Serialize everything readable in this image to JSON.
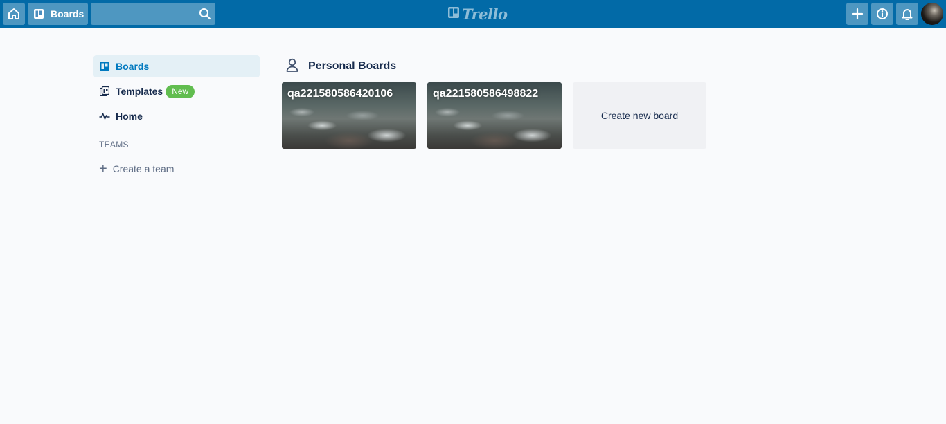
{
  "header": {
    "boards_label": "Boards",
    "search_value": "",
    "logo_text": "Trello"
  },
  "sidebar": {
    "items": [
      {
        "label": "Boards",
        "icon": "board-icon",
        "active": true
      },
      {
        "label": "Templates",
        "icon": "template-icon",
        "badge": "New"
      },
      {
        "label": "Home",
        "icon": "activity-icon"
      }
    ],
    "teams_title": "TEAMS",
    "create_team_label": "Create a team"
  },
  "main": {
    "section_title": "Personal Boards",
    "boards": [
      {
        "name": "qa221580586420106"
      },
      {
        "name": "qa221580586498822"
      }
    ],
    "create_board_label": "Create new board"
  },
  "colors": {
    "header": "#026aa7",
    "active": "#0079bf",
    "badge": "#61bd4f"
  }
}
